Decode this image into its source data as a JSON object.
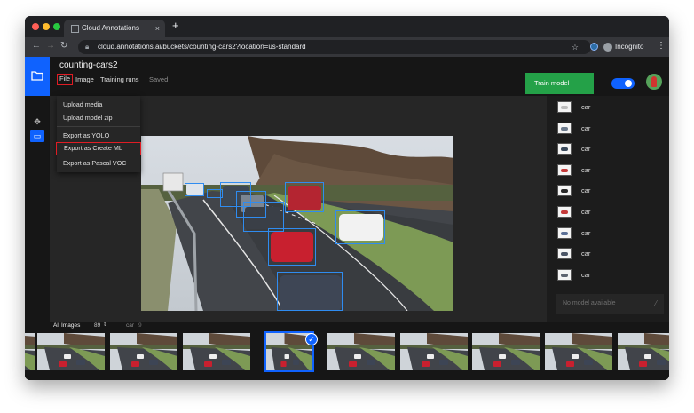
{
  "browser": {
    "tab_title": "Cloud Annotations",
    "tab_close": "×",
    "new_tab": "+",
    "back": "←",
    "forward": "→",
    "reload": "↻",
    "url": "cloud.annotations.ai/buckets/counting-cars2?location=us-standard",
    "incognito_label": "Incognito",
    "star": "☆",
    "menu": "⋮"
  },
  "header": {
    "project_name": "counting-cars2",
    "menus": {
      "file": "File",
      "image": "Image",
      "training_runs": "Training runs",
      "saved": "Saved"
    },
    "train_button": "Train model"
  },
  "file_menu": {
    "items": [
      "Upload media",
      "Upload model zip",
      "Export as YOLO",
      "Export as Create ML",
      "Export as Pascal VOC"
    ],
    "highlighted": "Export as Create ML"
  },
  "labels_panel": {
    "items": [
      {
        "name": "car",
        "color": "#bdbdbd"
      },
      {
        "name": "car",
        "color": "#6c7a8c"
      },
      {
        "name": "car",
        "color": "#3a4a5c"
      },
      {
        "name": "car",
        "color": "#c43a3a"
      },
      {
        "name": "car",
        "color": "#2a2a2a"
      },
      {
        "name": "car",
        "color": "#c43a3a"
      },
      {
        "name": "car",
        "color": "#5a6f96"
      },
      {
        "name": "car",
        "color": "#4b5566"
      },
      {
        "name": "car",
        "color": "#5d6470"
      }
    ],
    "model_placeholder": "No model available"
  },
  "filter_bar": {
    "all_images_label": "All Images",
    "all_images_count": "89",
    "label_name": "car",
    "label_count": "9"
  },
  "colors": {
    "accent": "#0f62fe",
    "train": "#24a148",
    "bbox": "#2f8cf0",
    "highlight": "#e01c24"
  },
  "icons": [
    "folder-icon",
    "move-tool-icon",
    "box-tool-icon",
    "magic-wand-icon",
    "check-icon",
    "lock-icon",
    "star-icon"
  ]
}
